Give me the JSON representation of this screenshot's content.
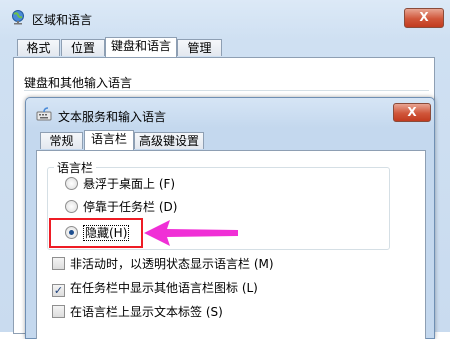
{
  "outer_window": {
    "title": "区域和语言",
    "close_label": "X",
    "tabs": [
      "格式",
      "位置",
      "键盘和语言",
      "管理"
    ],
    "active_tab": "键盘和语言",
    "group_label": "键盘和其他输入语言"
  },
  "inner_dialog": {
    "title": "文本服务和输入语言",
    "close_label": "X",
    "tabs": [
      "常规",
      "语言栏",
      "高级键设置"
    ],
    "active_tab": "语言栏",
    "language_bar_group": {
      "caption": "语言栏",
      "options": [
        {
          "label": "悬浮于桌面上 (F)",
          "selected": false
        },
        {
          "label": "停靠于任务栏 (D)",
          "selected": false
        },
        {
          "label": "隐藏(H)",
          "selected": true
        }
      ]
    },
    "checkboxes": [
      {
        "label": "非活动时，以透明状态显示语言栏 (M)",
        "checked": false
      },
      {
        "label": "在任务栏中显示其他语言栏图标 (L)",
        "checked": true
      },
      {
        "label": "在语言栏上显示文本标签 (S)",
        "checked": false
      }
    ]
  },
  "annotation": {
    "highlight_color": "#ee1c25",
    "arrow_color": "#f02fd6"
  },
  "colors": {
    "title_bar": "#cfe0f2",
    "close_button": "#d0563a"
  }
}
